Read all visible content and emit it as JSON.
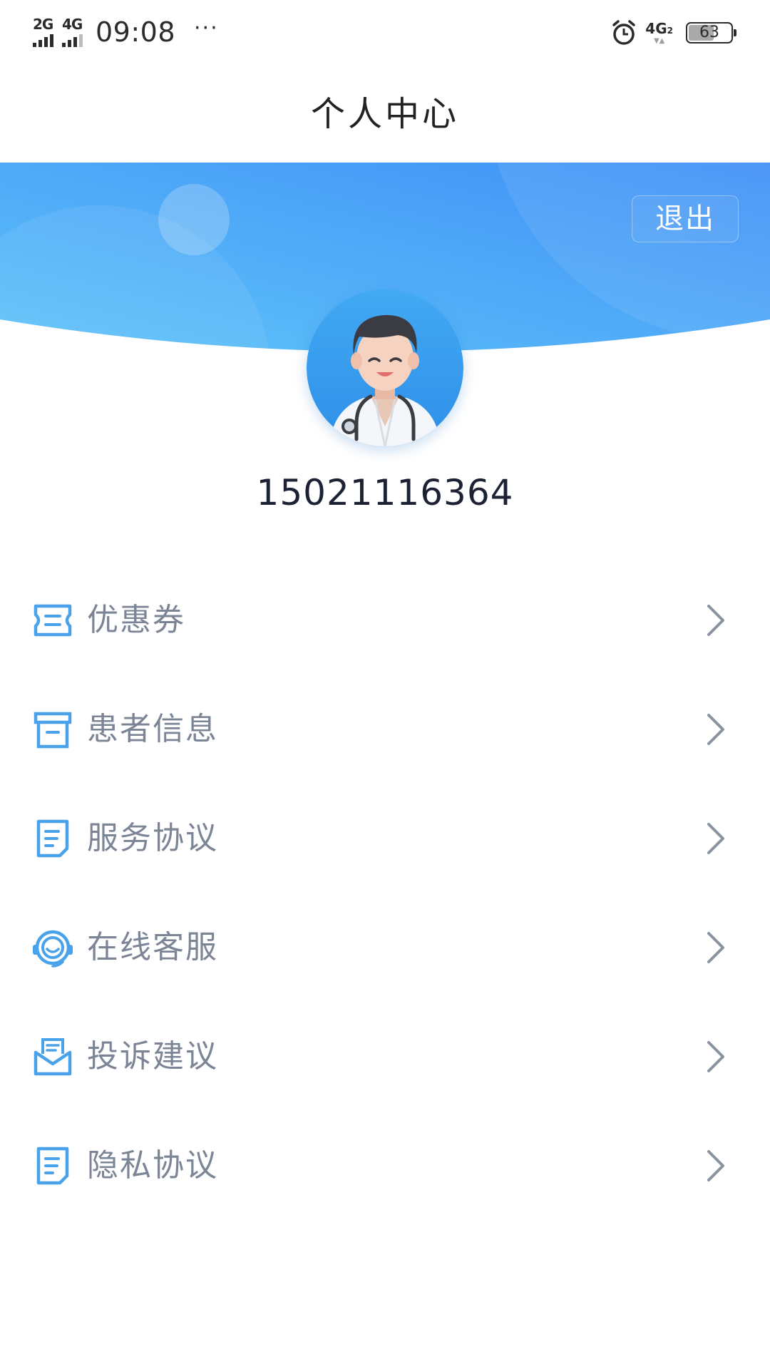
{
  "status_bar": {
    "sim1": "2G",
    "sim2": "4G",
    "time": "09:08",
    "more": "···",
    "network": "4G",
    "network_sub": "2",
    "battery": "63",
    "battery_level": 0.63
  },
  "header": {
    "title": "个人中心",
    "logout_label": "退出"
  },
  "profile": {
    "phone": "15021116364"
  },
  "menu": {
    "items": [
      {
        "label": "优惠券",
        "icon": "coupon-icon"
      },
      {
        "label": "患者信息",
        "icon": "archive-box-icon"
      },
      {
        "label": "服务协议",
        "icon": "document-icon"
      },
      {
        "label": "在线客服",
        "icon": "headset-icon"
      },
      {
        "label": "投诉建议",
        "icon": "mail-icon"
      },
      {
        "label": "隐私协议",
        "icon": "document-icon"
      }
    ]
  },
  "colors": {
    "accent": "#4a9ff5",
    "banner_start": "#3f8ff7",
    "banner_end": "#5fc0f7",
    "icon_blue": "#4aa3ea",
    "label_gray": "#7b8596"
  }
}
